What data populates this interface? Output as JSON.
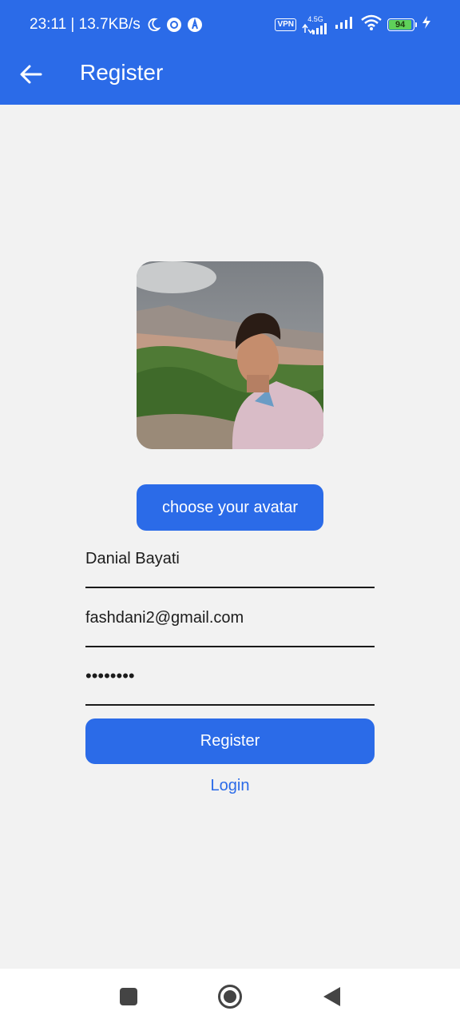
{
  "status_bar": {
    "time_speed": "23:11 | 13.7KB/s",
    "vpn": "VPN",
    "network_type": "4.5G",
    "battery": "94",
    "icons": [
      "moon-icon",
      "settings-dot-icon",
      "app-dot-icon",
      "signal-icon",
      "signal-icon-2",
      "wifi-icon",
      "charging-icon"
    ]
  },
  "app_bar": {
    "title": "Register",
    "back_icon": "arrow-left-icon"
  },
  "form": {
    "avatar_button": "choose your avatar",
    "name_value": "Danial Bayati",
    "email_value": "fashdani2@gmail.com",
    "password_value": "••••••••",
    "register_button": "Register",
    "login_link": "Login"
  },
  "nav_bar": {
    "icons": [
      "recents-square-icon",
      "home-circle-icon",
      "back-triangle-icon"
    ]
  },
  "colors": {
    "primary": "#2b6be8",
    "background": "#f2f2f2"
  }
}
